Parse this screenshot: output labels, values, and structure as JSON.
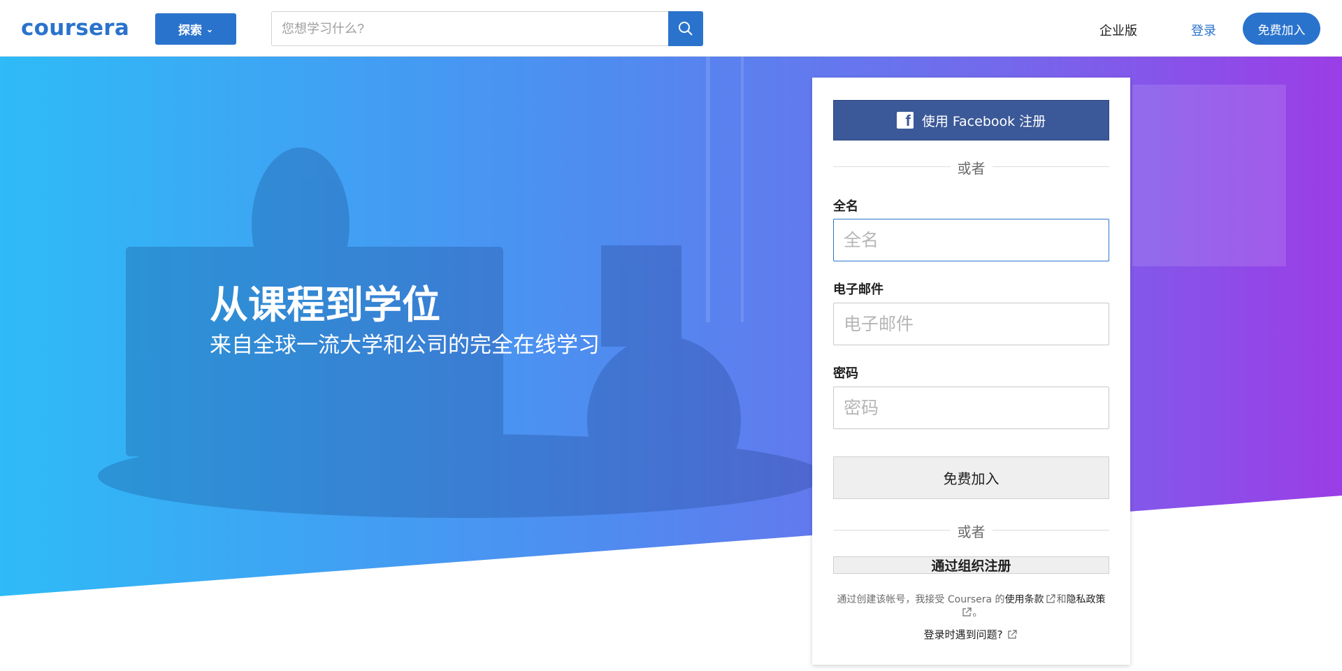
{
  "header": {
    "logo": "coursera",
    "explore_label": "探索",
    "search_placeholder": "您想学习什么?",
    "enterprise_label": "企业版",
    "login_label": "登录",
    "join_label": "免费加入"
  },
  "hero": {
    "title": "从课程到学位",
    "subtitle": "来自全球一流大学和公司的完全在线学习"
  },
  "signup": {
    "facebook_label": "使用 Facebook 注册",
    "or_label": "或者",
    "fullname_label": "全名",
    "fullname_placeholder": "全名",
    "email_label": "电子邮件",
    "email_placeholder": "电子邮件",
    "password_label": "密码",
    "password_placeholder": "密码",
    "join_button": "免费加入",
    "org_button": "通过组织注册",
    "terms_prefix": "通过创建该帐号，我接受 Coursera 的",
    "terms_link": "使用条款",
    "terms_and": "和",
    "privacy_link": "隐私政策",
    "terms_suffix": "。",
    "help_link": "登录时遇到问题?"
  },
  "colors": {
    "brand": "#2a73cc",
    "facebook": "#3b5998",
    "hero_gradient_start": "#2ebbf7",
    "hero_gradient_end": "#9b3de6"
  }
}
